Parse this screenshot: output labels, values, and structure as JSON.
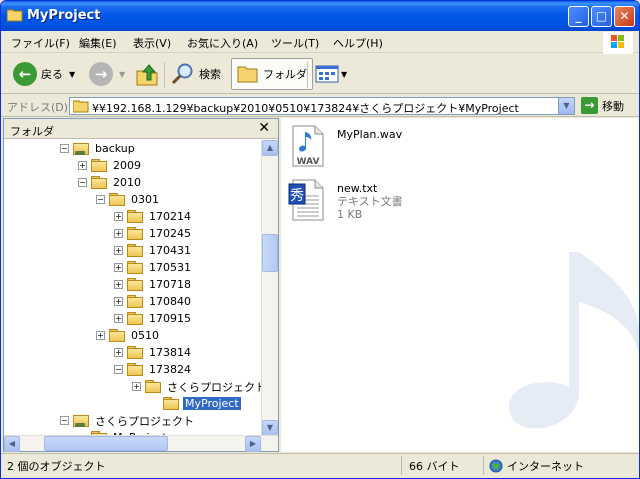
{
  "window": {
    "title": "MyProject"
  },
  "menu": [
    "ファイル(F)",
    "編集(E)",
    "表示(V)",
    "お気に入り(A)",
    "ツール(T)",
    "ヘルプ(H)"
  ],
  "toolbar": {
    "back_label": "戻る",
    "search_label": "検索",
    "folders_label": "フォルダ"
  },
  "address": {
    "label": "アドレス(D)",
    "value": "¥¥192.168.1.129¥backup¥2010¥0510¥173824¥さくらプロジェクト¥MyProject",
    "go_label": "移動"
  },
  "folder_pane": {
    "title": "フォルダ",
    "tree": [
      {
        "label": "backup",
        "level": 0,
        "expanded": true,
        "type": "net"
      },
      {
        "label": "2009",
        "level": 1,
        "expanded": false
      },
      {
        "label": "2010",
        "level": 1,
        "expanded": true
      },
      {
        "label": "0301",
        "level": 2,
        "expanded": true
      },
      {
        "label": "170214",
        "level": 3,
        "expanded": false
      },
      {
        "label": "170245",
        "level": 3,
        "expanded": false
      },
      {
        "label": "170431",
        "level": 3,
        "expanded": false
      },
      {
        "label": "170531",
        "level": 3,
        "expanded": false
      },
      {
        "label": "170718",
        "level": 3,
        "expanded": false
      },
      {
        "label": "170840",
        "level": 3,
        "expanded": false
      },
      {
        "label": "170915",
        "level": 3,
        "expanded": false
      },
      {
        "label": "0510",
        "level": 2,
        "expanded": false
      },
      {
        "label": "173814",
        "level": 3,
        "expanded": false
      },
      {
        "label": "173824",
        "level": 3,
        "expanded": true
      },
      {
        "label": "さくらプロジェクト",
        "level": 4,
        "expanded": false
      },
      {
        "label": "MyProject",
        "level": 5,
        "selected": true
      },
      {
        "label": "さくらプロジェクト",
        "level": 0,
        "expanded": true,
        "type": "net"
      },
      {
        "label": "MyProject",
        "level": 1
      }
    ]
  },
  "files": [
    {
      "name": "MyPlan.wav",
      "icon": "wav-file-icon",
      "icon_text": "WAV"
    },
    {
      "name": "new.txt",
      "type": "テキスト文書",
      "size": "1 KB",
      "icon": "text-file-icon",
      "icon_text": "秀"
    }
  ],
  "status": {
    "objects": "2 個のオブジェクト",
    "size": "66 バイト",
    "zone": "インターネット"
  },
  "colors": {
    "titlebar": "#0054e3",
    "selection": "#316ac5",
    "address_border": "#7f9db9"
  }
}
